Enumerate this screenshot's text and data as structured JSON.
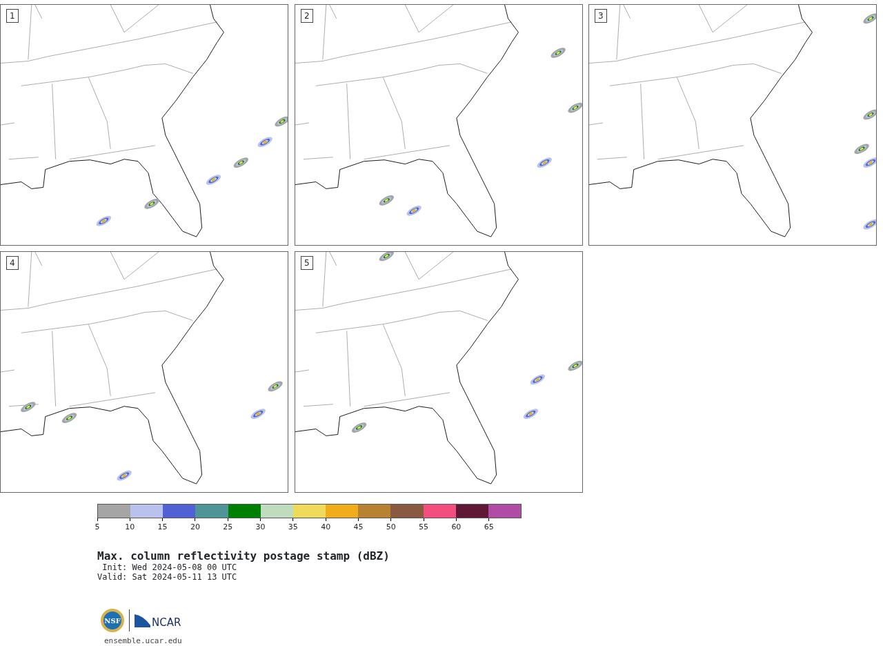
{
  "panels": [
    {
      "label": "1"
    },
    {
      "label": "2"
    },
    {
      "label": "3"
    },
    {
      "label": "4"
    },
    {
      "label": "5"
    }
  ],
  "colorbar": {
    "bins": [
      {
        "color": "#a5a5a5"
      },
      {
        "color": "#b8c2ec"
      },
      {
        "color": "#5060d5"
      },
      {
        "color": "#4f9598"
      },
      {
        "color": "#008000"
      },
      {
        "color": "#bfddbe"
      },
      {
        "color": "#f0da5a"
      },
      {
        "color": "#f0ac1a"
      },
      {
        "color": "#b88330"
      },
      {
        "color": "#8a5a40"
      },
      {
        "color": "#f34f7e"
      },
      {
        "color": "#5f1937"
      },
      {
        "color": "#b04ca6"
      }
    ],
    "ticks": [
      "5",
      "10",
      "15",
      "20",
      "25",
      "30",
      "35",
      "40",
      "45",
      "50",
      "55",
      "60",
      "65"
    ]
  },
  "title": "Max. column reflectivity postage stamp (dBZ)",
  "init": " Init: Wed 2024-05-08 00 UTC",
  "valid": "Valid: Sat 2024-05-11 13 UTC",
  "logos": {
    "nsf": "NSF",
    "ncar": "NCAR"
  },
  "footer": "ensemble.ucar.edu"
}
